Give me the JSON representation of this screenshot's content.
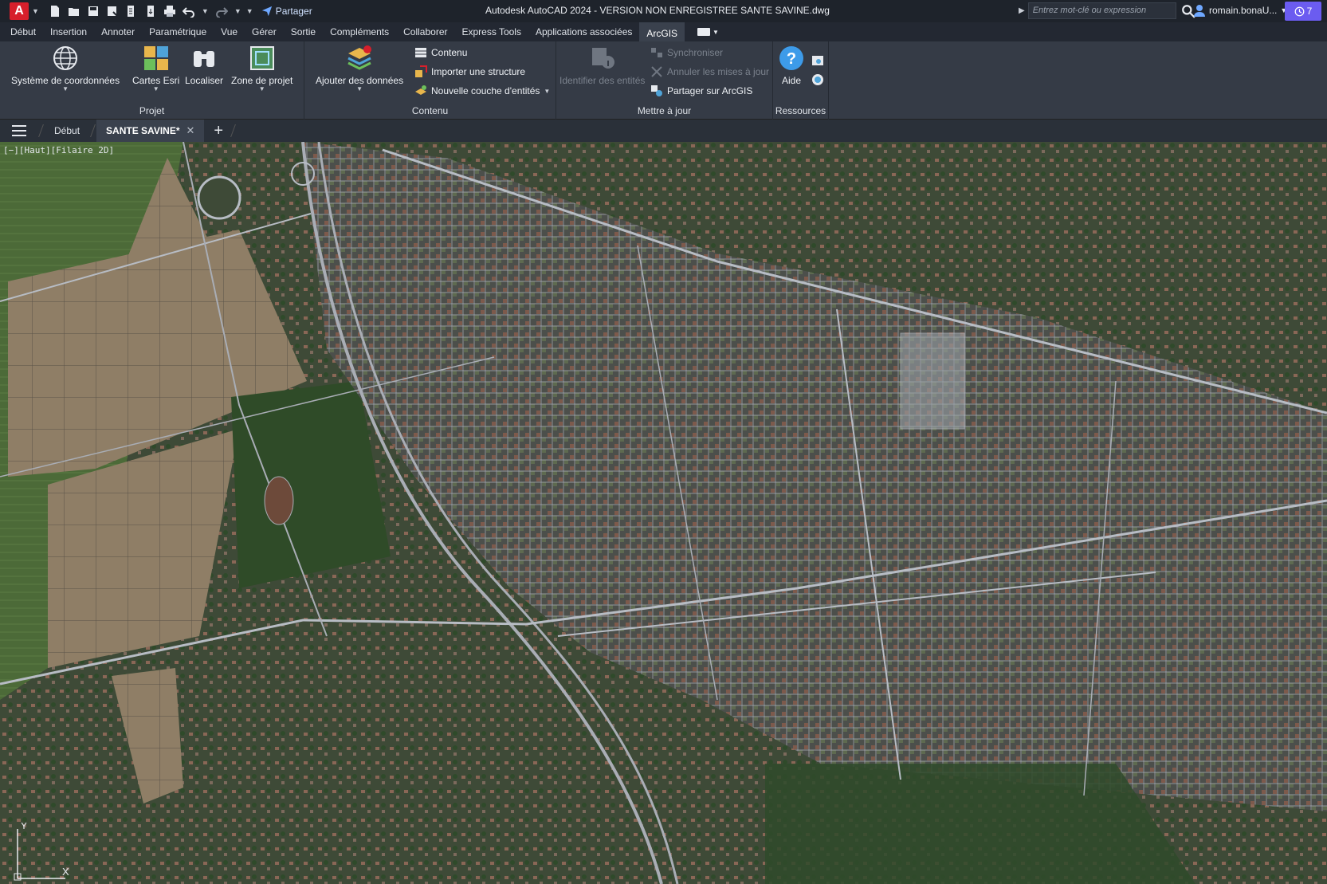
{
  "titlebar": {
    "app_logo": "A",
    "share_label": "Partager",
    "window_title": "Autodesk AutoCAD 2024 - VERSION NON ENREGISTREE    SANTE SAVINE.dwg",
    "search_placeholder": "Entrez mot-clé ou expression",
    "user_name": "romain.bonaU...",
    "badge_count": "7"
  },
  "menu": {
    "tabs": [
      "Début",
      "Insertion",
      "Annoter",
      "Paramétrique",
      "Vue",
      "Gérer",
      "Sortie",
      "Compléments",
      "Collaborer",
      "Express Tools",
      "Applications associées",
      "ArcGIS"
    ],
    "active": "ArcGIS"
  },
  "ribbon": {
    "projet": {
      "title": "Projet",
      "systeme": "Système de coordonnées",
      "cartes": "Cartes Esri",
      "localiser": "Localiser",
      "zone": "Zone de projet"
    },
    "contenu": {
      "title": "Contenu",
      "ajouter": "Ajouter des données",
      "contenu": "Contenu",
      "importer": "Importer une structure",
      "nouvelle": "Nouvelle couche d'entités"
    },
    "maj": {
      "title": "Mettre à jour",
      "identifier": "Identifier des entités",
      "synchroniser": "Synchroniser",
      "annuler": "Annuler les mises à jour",
      "partager": "Partager sur ArcGIS"
    },
    "ressources": {
      "title": "Ressources",
      "aide": "Aide"
    }
  },
  "doc_tabs": {
    "start": "Début",
    "active": "SANTE SAVINE*",
    "close_glyph": "✕",
    "add_glyph": "+"
  },
  "viewport": {
    "label": "[−][Haut][Filaire 2D]",
    "ucs_x": "X",
    "ucs_y": "Y"
  },
  "colors": {
    "accent": "#6b5cf0",
    "logo": "#d71f2b",
    "ribbon": "#353b46",
    "lines": "#c8ccd4"
  }
}
